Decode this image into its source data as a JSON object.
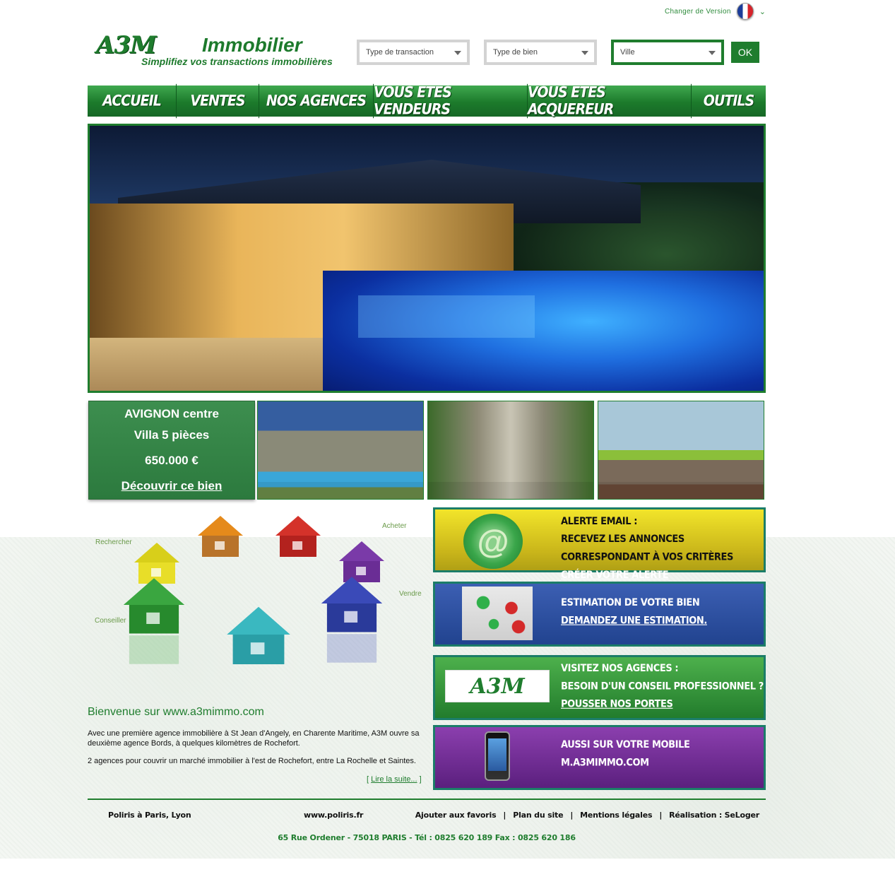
{
  "topbar": {
    "version_link": "Changer de Version",
    "flag_icon": "france-flag-icon"
  },
  "logo": {
    "mark": "A3M",
    "name": "Immobilier",
    "tagline": "Simplifiez vos transactions immobilières"
  },
  "search": {
    "transaction_type": "Type de transaction",
    "property_type": "Type de bien",
    "city": "Ville",
    "ok_label": "OK"
  },
  "nav": {
    "items": [
      {
        "label": "ACCUEIL"
      },
      {
        "label": "VENTES"
      },
      {
        "label": "NOS AGENCES"
      },
      {
        "label": "VOUS ETES VENDEURS"
      },
      {
        "label": "VOUS ETES  ACQUEREUR"
      },
      {
        "label": "OUTILS"
      }
    ]
  },
  "featured": {
    "location": "AVIGNON centre",
    "title": "Villa 5 pièces",
    "price": "650.000 €",
    "cta": "Découvrir ce bien"
  },
  "illustration": {
    "labels": {
      "rechercher": "Rechercher",
      "acheter": "Acheter",
      "vendre": "Vendre",
      "conseiller": "Conseiller"
    }
  },
  "welcome": {
    "title": "Bienvenue sur www.a3mimmo.com",
    "paragraph1": "Avec une première agence immobilière à St Jean d'Angely, en Charente Maritime, A3M ouvre sa deuxième agence Bords, à quelques kilomètres de Rochefort.",
    "paragraph2": "2 agences pour couvrir un marché immobilier à l'est de Rochefort, entre La Rochelle et Saintes.",
    "read_more_open": "[ ",
    "read_more": "Lire la suite...",
    "read_more_close": " ]"
  },
  "boxes": {
    "alert": {
      "line1": "ALERTE EMAIL :",
      "line2": "RECEVEZ LES ANNONCES CORRESPONDANT À VOS CRITÈRES",
      "link": "CRÉER VOTRE ALERTE",
      "icon": "at-sign-icon"
    },
    "estimation": {
      "line1": "ESTIMATION DE VOTRE BIEN",
      "link": "DEMANDEZ UNE ESTIMATION.",
      "icon": "houses-icon"
    },
    "agencies": {
      "line1": "VISITEZ NOS AGENCES :",
      "line2": "BESOIN D'UN CONSEIL PROFESSIONNEL ?",
      "link": "POUSSER NOS PORTES",
      "logo": "A3M"
    },
    "mobile": {
      "line1": "AUSSI SUR VOTRE  MOBILE",
      "line2": "M.A3MIMMO.COM",
      "icon": "smartphone-icon"
    }
  },
  "footer": {
    "left1": "Poliris à Paris, Lyon",
    "left2": "www.poliris.fr",
    "links": [
      "Ajouter aux favoris",
      "Plan du site",
      "Mentions légales",
      "Réalisation : SeLoger"
    ],
    "separator": "|",
    "address": "65 Rue Ordener - 75018 PARIS  -  Tél : 0825 620 189  Fax : 0825 620 186"
  },
  "colors": {
    "brand_green": "#1f7d2e",
    "alert_yellow": "#e8d926",
    "estimation_blue": "#2f4fa3",
    "agency_green": "#3a9a3e",
    "mobile_purple": "#7a34a0"
  }
}
